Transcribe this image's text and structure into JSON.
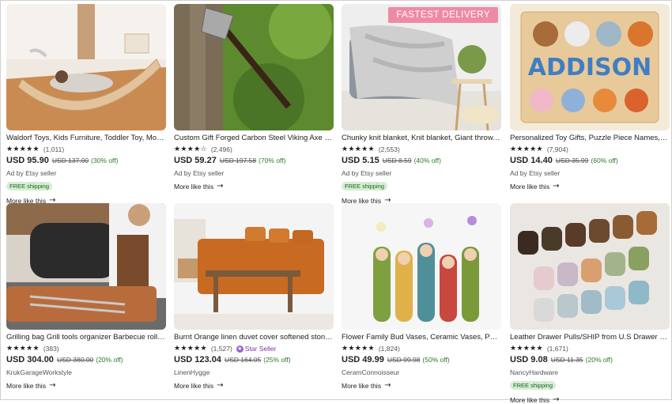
{
  "listings": [
    {
      "title": "Waldorf Toys, Kids Furniture, Toddler Toy, Montessori Climber",
      "stars": "★★★★★",
      "reviews": "(1,011)",
      "price": "USD 95.90",
      "original": "USD 137.00",
      "discount": "(30% off)",
      "ad": "Ad by Etsy seller",
      "shipping": "FREE shipping",
      "more": "More like this",
      "badge": ""
    },
    {
      "title": "Custom Gift Forged Carbon Steel Viking Axe Handmade",
      "stars": "★★★★☆",
      "reviews": "(2,496)",
      "price": "USD 59.27",
      "original": "USD 197.58",
      "discount": "(70% off)",
      "ad": "Ad by Etsy seller",
      "shipping": "",
      "more": "More like this",
      "badge": ""
    },
    {
      "title": "Chunky knit blanket, Knit blanket, Giant throw, Merino",
      "stars": "★★★★★",
      "reviews": "(2,553)",
      "price": "USD 5.15",
      "original": "USD 8.59",
      "discount": "(40% off)",
      "ad": "Ad by Etsy seller",
      "shipping": "FREE shipping",
      "more": "More like this",
      "badge": "FASTEST DELIVERY"
    },
    {
      "title": "Personalized Toy Gifts, Puzzle Piece Names, Custom",
      "stars": "★★★★★",
      "reviews": "(7,904)",
      "price": "USD 14.40",
      "original": "USD 35.99",
      "discount": "(60% off)",
      "ad": "Ad by Etsy seller",
      "shipping": "",
      "more": "More like this",
      "badge": ""
    },
    {
      "title": "Grilling bag Grill tools organizer Barbecue roll up bag",
      "stars": "★★★★★",
      "reviews": "(383)",
      "price": "USD 304.00",
      "original": "USD 380.00",
      "discount": "(20% off)",
      "ad": "KrukGarageWorkstyle",
      "shipping": "",
      "more": "More like this",
      "badge": ""
    },
    {
      "title": "Burnt Orange linen duvet cover softened stonewashed",
      "stars": "★★★★★",
      "reviews": "(1,527)",
      "starSeller": "Star Seller",
      "price": "USD 123.04",
      "original": "USD 164.05",
      "discount": "(25% off)",
      "ad": "LinenHygge",
      "shipping": "",
      "more": "More like this",
      "badge": ""
    },
    {
      "title": "Flower Family Bud Vases, Ceramic Vases, Pottery Vases",
      "stars": "★★★★★",
      "reviews": "(1,824)",
      "price": "USD 49.99",
      "original": "USD 99.98",
      "discount": "(50% off)",
      "ad": "CeramConnoisseur",
      "shipping": "",
      "more": "More like this",
      "badge": ""
    },
    {
      "title": "Leather Drawer Pulls/SHIP from U.S Drawer Knobs",
      "stars": "★★★★★",
      "reviews": "(1,671)",
      "price": "USD 9.08",
      "original": "USD 11.35",
      "discount": "(20% off)",
      "ad": "NancyHardware",
      "shipping": "FREE shipping",
      "more": "More like this",
      "badge": ""
    }
  ],
  "puzzle_text": "ADDISON"
}
